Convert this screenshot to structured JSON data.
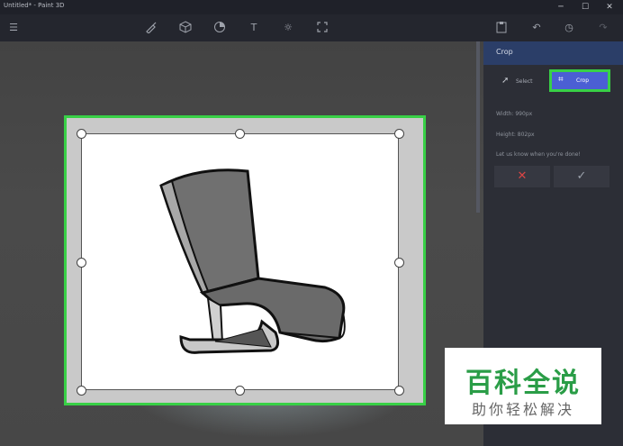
{
  "window": {
    "title": "Untitled* - Paint 3D",
    "minimize": "─",
    "maximize": "☐",
    "close": "✕"
  },
  "toolbar": {
    "menu_icon": "menu-icon",
    "tools": [
      "brushes-icon",
      "3d-shapes-icon",
      "stickers-icon",
      "text-icon",
      "effects-icon",
      "canvas-icon"
    ],
    "right": [
      "paste-icon",
      "undo-icon",
      "history-icon",
      "redo-icon"
    ]
  },
  "panel": {
    "title": "Crop",
    "select_label": "Select",
    "crop_label": "Crop",
    "width_text": "Width: 990px",
    "height_text": "Height: 802px",
    "hint_text": "Let us know when you're done!",
    "cancel_glyph": "✕",
    "confirm_glyph": "✓"
  },
  "colors": {
    "highlight": "#38d046",
    "crop_button": "#4b5fd4",
    "cancel": "#d94545",
    "confirm": "#9aa0aa"
  },
  "watermark": {
    "main": "百科全说",
    "sub": "助你轻松解决"
  }
}
